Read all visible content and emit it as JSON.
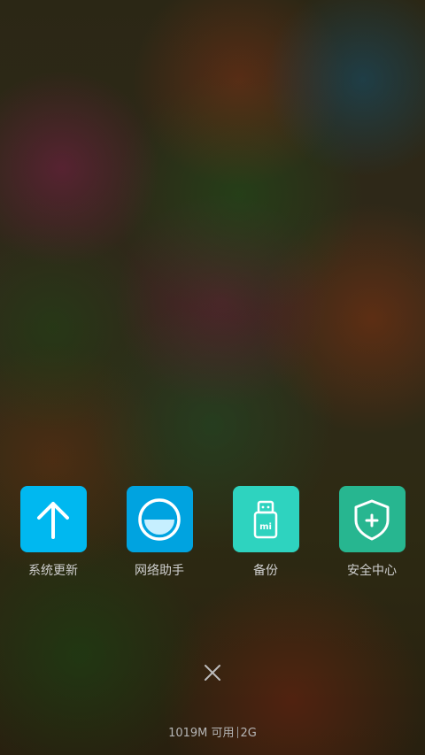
{
  "apps": [
    {
      "label": "系统更新",
      "icon": "arrow-up-icon",
      "color": "#00b8f0"
    },
    {
      "label": "网络助手",
      "icon": "network-half-circle-icon",
      "color": "#00a3e0"
    },
    {
      "label": "备份",
      "icon": "usb-drive-mi-icon",
      "color": "#2ed3bf",
      "icon_text": "mi"
    },
    {
      "label": "安全中心",
      "icon": "shield-plus-icon",
      "color": "#27b690"
    }
  ],
  "close": {
    "icon": "close-icon"
  },
  "memory": {
    "available": "1019M 可用",
    "total": "2G"
  }
}
